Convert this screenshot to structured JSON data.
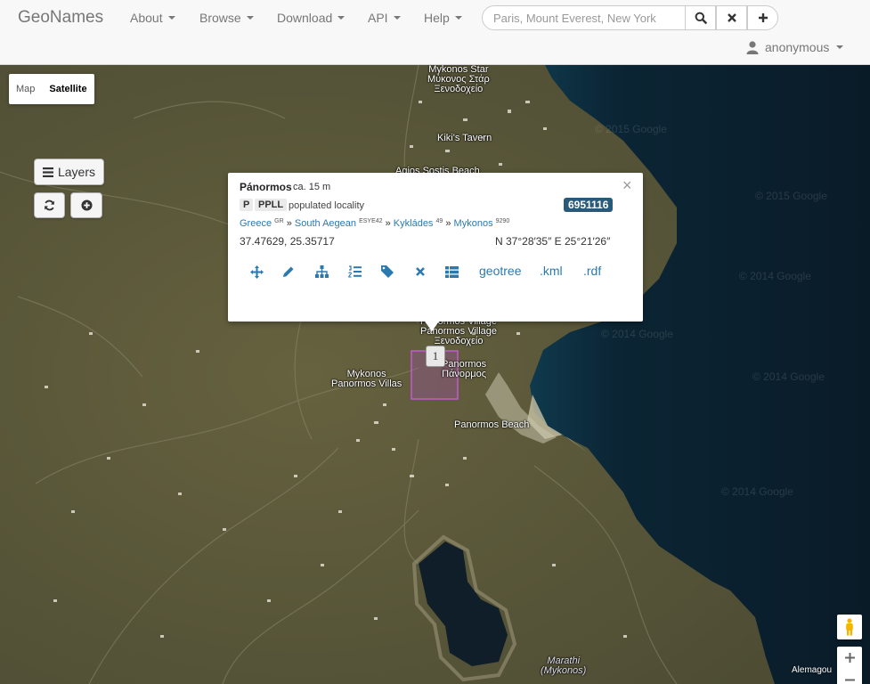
{
  "brand": "GeoNames",
  "nav": {
    "about": "About",
    "browse": "Browse",
    "download": "Download",
    "api": "API",
    "help": "Help"
  },
  "search": {
    "placeholder": "Paris, Mount Everest, New York"
  },
  "user": {
    "name": "anonymous"
  },
  "map": {
    "type_map": "Map",
    "type_satellite": "Satellite",
    "active_type": "Satellite",
    "layers_label": "Layers",
    "cluster_count": "1",
    "attribution": "Alemagou",
    "labels": {
      "mykonos_star_1": "Mykonos Star",
      "mykonos_star_2": "Μύκονος Στάρ",
      "mykonos_star_3": "Ξενοδοχείο",
      "kikis_tavern": "Kiki's Tavern",
      "agios_sostis": "Agios Sostis Beach",
      "panormos_village_1": "Panormos Village",
      "panormos_village_2": "Panormos Village",
      "panormos_village_3": "Ξενοδοχείο",
      "panormos_1": "Panormos",
      "panormos_2": "Πάνορμος",
      "villas_1": "Mykonos",
      "villas_2": "Panormos Villas",
      "panormos_beach": "Panormos Beach",
      "marathi_1": "Marathi",
      "marathi_2": "(Mykonos)"
    },
    "watermarks": [
      "© 2015 Google",
      "© 2015 Google",
      "© 2014 Google",
      "© 2014 Google",
      "© 2014 Google",
      "© 2014 Google"
    ]
  },
  "popup": {
    "name": "Pánormos",
    "elevation": "ca. 15 m",
    "id": "6951116",
    "feature_class": "P",
    "feature_code": "PPLL",
    "description": "populated locality",
    "breadcrumb": [
      {
        "name": "Greece",
        "code": "GR"
      },
      {
        "name": "South Aegean",
        "code": "ESYE42"
      },
      {
        "name": "Kykládes",
        "code": "49"
      },
      {
        "name": "Mykonos",
        "code": "9290"
      }
    ],
    "separator": "»",
    "coords": "37.47629, 25.35717",
    "dms": "N 37°28′35″ E 25°21′26″",
    "links": {
      "geotree": "geotree",
      "kml": ".kml",
      "rdf": ".rdf"
    },
    "close": "×"
  },
  "colors": {
    "link": "#2a7ab0",
    "id_badge": "#2a5a79",
    "sea": "#0d2233",
    "land": "#5b5a3c"
  }
}
